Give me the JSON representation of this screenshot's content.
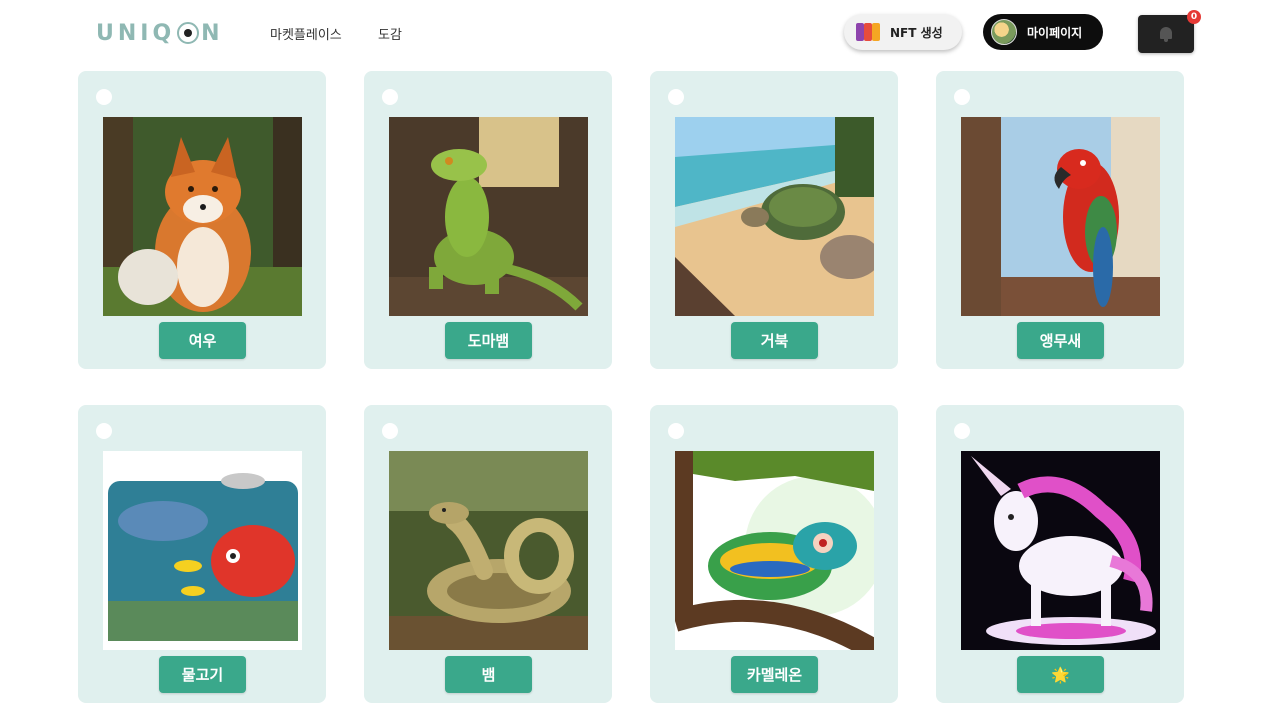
{
  "header": {
    "logo": "UNIQ N",
    "nav": [
      "마켓플레이스",
      "도감"
    ],
    "nft_button": "NFT 생성",
    "mypage_button": "마이페이지",
    "notification_count": "0"
  },
  "cards": [
    {
      "label": "여우",
      "image": "fox"
    },
    {
      "label": "도마뱀",
      "image": "lizard"
    },
    {
      "label": "거북",
      "image": "turtle"
    },
    {
      "label": "앵무새",
      "image": "parrot"
    },
    {
      "label": "물고기",
      "image": "fish"
    },
    {
      "label": "뱀",
      "image": "snake"
    },
    {
      "label": "카멜레온",
      "image": "chameleon"
    },
    {
      "label": "🌟",
      "image": "unicorn"
    }
  ]
}
